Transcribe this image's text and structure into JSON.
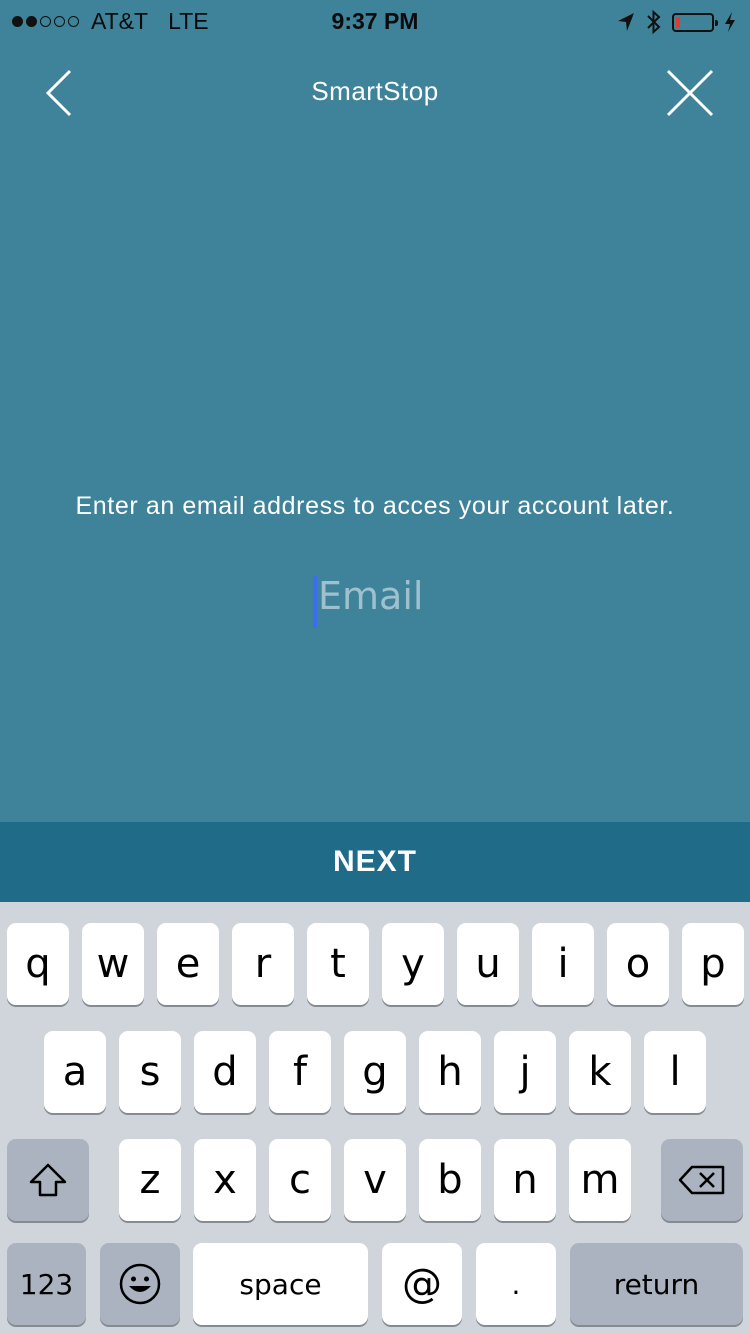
{
  "status_bar": {
    "carrier": "AT&T",
    "network": "LTE",
    "time": "9:37 PM",
    "signal_bars": 2,
    "signal_total": 5,
    "battery_level": 0.12,
    "icons": [
      "location-arrow-icon",
      "bluetooth-icon",
      "battery-icon",
      "charging-bolt-icon"
    ]
  },
  "nav": {
    "title": "SmartStop",
    "back_icon": "chevron-left-icon",
    "close_icon": "close-icon"
  },
  "form": {
    "prompt": "Enter an email address to acces your account later.",
    "email_placeholder": "Email",
    "email_value": ""
  },
  "next_label": "NEXT",
  "keyboard": {
    "row1": [
      "q",
      "w",
      "e",
      "r",
      "t",
      "y",
      "u",
      "i",
      "o",
      "p"
    ],
    "row2": [
      "a",
      "s",
      "d",
      "f",
      "g",
      "h",
      "j",
      "k",
      "l"
    ],
    "row3": [
      "z",
      "x",
      "c",
      "v",
      "b",
      "n",
      "m"
    ],
    "numbers_label": "123",
    "space_label": "space",
    "at_label": "@",
    "dot_label": ".",
    "return_label": "return",
    "shift_icon": "shift-icon",
    "backspace_icon": "backspace-icon",
    "emoji_icon": "emoji-icon"
  },
  "colors": {
    "background": "#3e8399",
    "next_bar": "#206c88",
    "caret": "#3a6df0",
    "battery_low": "#e43a2e",
    "keyboard": "#d0d5dc"
  }
}
